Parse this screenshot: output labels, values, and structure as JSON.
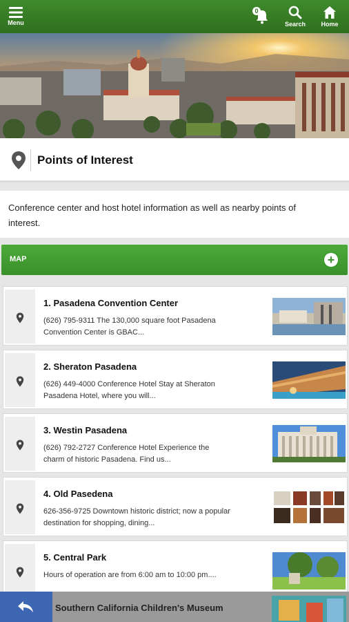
{
  "header": {
    "menu_label": "Menu",
    "notification_count": "0",
    "search_label": "Search",
    "home_label": "Home",
    "bar_color": "#2f6f1f"
  },
  "page": {
    "title": "Points of Interest",
    "description": "Conference center and host hotel information as well as nearby points of interest."
  },
  "map_section": {
    "label": "MAP",
    "accent_color": "#3b962b"
  },
  "items": [
    {
      "title": "1. Pasadena Convention Center",
      "description": "(626) 795-9311 The 130,000 square foot Pasadena Convention Center is GBAC...",
      "icon": "map-pin-icon"
    },
    {
      "title": "2. Sheraton Pasadena",
      "description": "(626) 449-4000 Conference Hotel Stay at Sheraton Pasadena Hotel, where you will...",
      "icon": "map-pin-icon"
    },
    {
      "title": "3. Westin Pasadena",
      "description": "(626) 792-2727 Conference Hotel Experience the charm of historic Pasadena. Find us...",
      "icon": "map-pin-icon"
    },
    {
      "title": "4. Old Pasedena",
      "description": "626-356-9725 Downtown historic district; now a popular destination for shopping, dining...",
      "icon": "map-pin-icon"
    },
    {
      "title": "5. Central Park",
      "description": "Hours of operation are from 6:00 am to 10:00 pm....",
      "icon": "map-pin-icon"
    }
  ],
  "bottom": {
    "partial_item_title": "Southern California Children's Museum",
    "back_color": "#3d66b3"
  }
}
